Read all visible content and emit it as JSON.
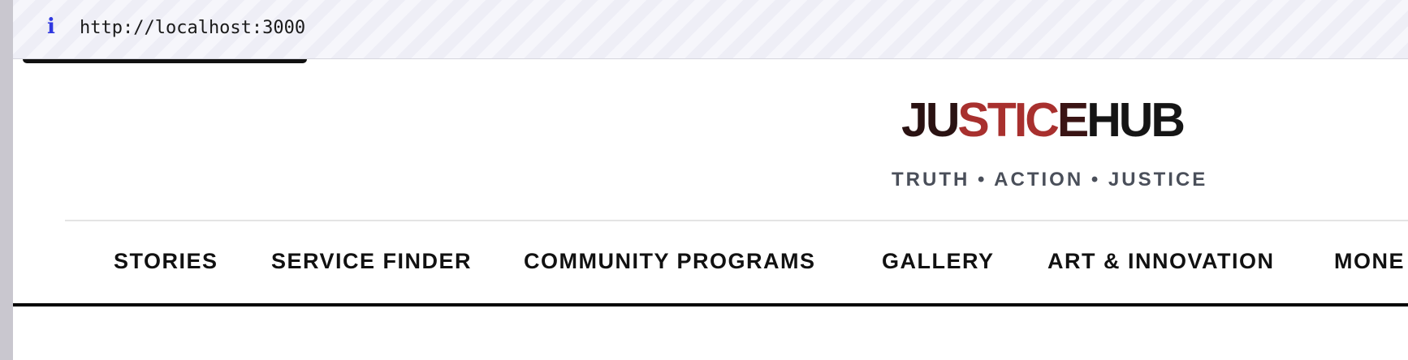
{
  "browser": {
    "url": "http://localhost:3000",
    "info_icon": "i"
  },
  "site": {
    "logo": {
      "part1": "JU",
      "part2": "STIC",
      "part3": "E",
      "part4": "HUB"
    },
    "tagline": "TRUTH • ACTION • JUSTICE"
  },
  "nav": {
    "items": [
      {
        "label": "STORIES"
      },
      {
        "label": "SERVICE FINDER"
      },
      {
        "label": "COMMUNITY PROGRAMS"
      },
      {
        "label": "GALLERY"
      },
      {
        "label": "ART & INNOVATION"
      },
      {
        "label": "MONE"
      }
    ]
  },
  "colors": {
    "logo_dark": "#2a1212",
    "logo_red": "#a8302e",
    "tagline": "#4a4f5a",
    "url_info_icon": "#2f38e0"
  }
}
